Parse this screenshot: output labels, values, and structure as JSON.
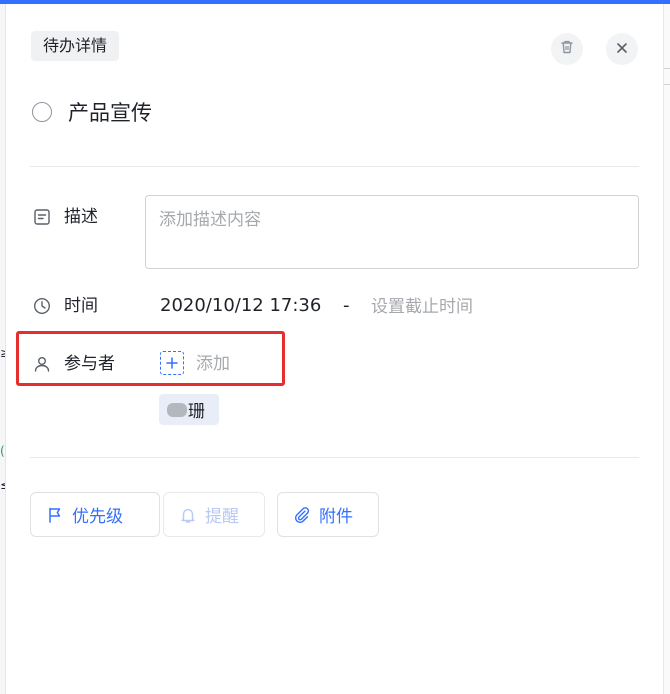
{
  "header": {
    "title": "待办详情"
  },
  "task": {
    "title": "产品宣传"
  },
  "description": {
    "label": "描述",
    "placeholder": "添加描述内容"
  },
  "time": {
    "label": "时间",
    "start": "2020/10/12 17:36",
    "separator": "-",
    "deadline_placeholder": "设置截止时间"
  },
  "participants": {
    "label": "参与者",
    "add_label": "添加",
    "members": [
      {
        "name": "珊"
      }
    ]
  },
  "actions": [
    {
      "label": "优先级",
      "icon": "flag-icon"
    },
    {
      "label": "提醒",
      "icon": "bell-icon"
    },
    {
      "label": "附件",
      "icon": "paperclip-icon"
    }
  ],
  "colors": {
    "accent": "#3370ff",
    "highlight": "#e62e2e",
    "placeholder": "#a6a9ad",
    "text": "#1f2329"
  }
}
